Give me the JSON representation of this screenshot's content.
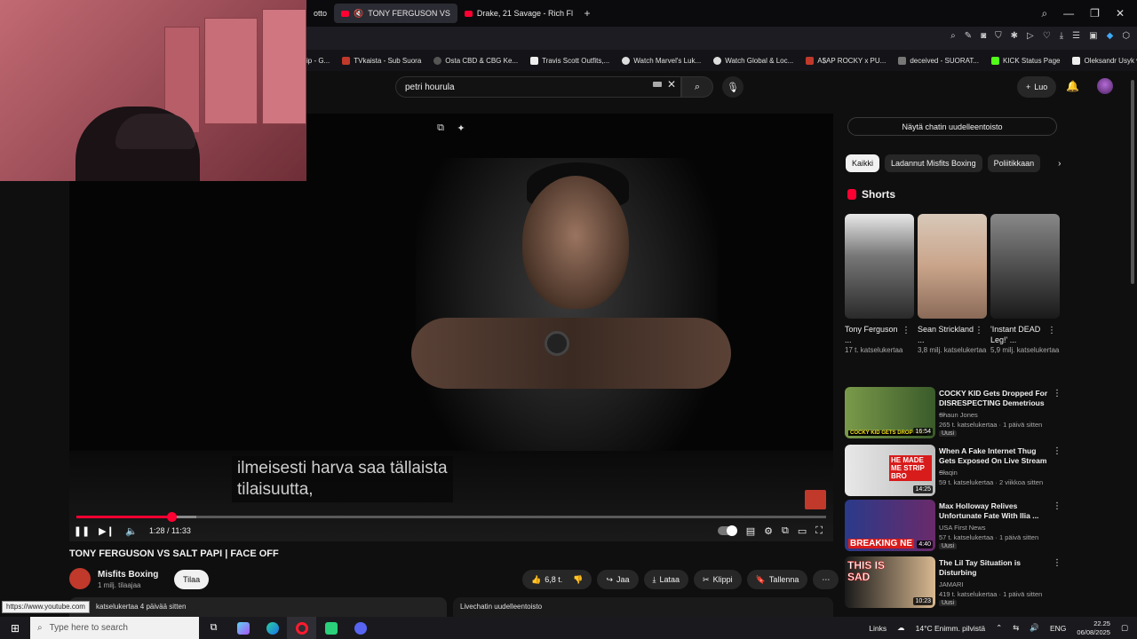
{
  "browser": {
    "tabs": [
      {
        "label": "otto"
      },
      {
        "label": "TONY FERGUSON VS",
        "active": true
      },
      {
        "label": "Drake, 21 Savage - Rich Fl"
      }
    ],
    "add_tab": "+",
    "bookmarks": [
      "ip - G...",
      "TVkaista - Sub Suora",
      "Osta CBD & CBG Ke...",
      "Travis Scott Outfits,...",
      "Watch Marvel's Luk...",
      "Watch Global & Loc...",
      "A$AP ROCKY x PU...",
      "deceived - SUORAT...",
      "KICK Status Page",
      "Oleksandr Usyk vs D..."
    ]
  },
  "youtube": {
    "search_value": "petri hourula",
    "create_label": "Luo"
  },
  "player": {
    "subtitle_line1": "ilmeisesti harva saa tällaista",
    "subtitle_line2": "tilaisuutta,",
    "time": "1:28 / 11:33",
    "progress": 0.127,
    "buffered": 0.16
  },
  "video": {
    "title": "TONY FERGUSON VS SALT PAPI | FACE OFF",
    "channel": "Misfits Boxing",
    "subscribers": "1 milj. tilaajaa",
    "subscribe_label": "Tilaa",
    "likes": "6,8 t.",
    "share": "Jaa",
    "download": "Lataa",
    "clip": "Klippi",
    "save": "Tallenna",
    "desc_text": "katselukertaa  4 päivää sitten",
    "status_url": "https://www.youtube.com",
    "live_chat_replay": "Livechatin uudelleentoisto"
  },
  "sidebar": {
    "show_chat": "Näytä chatin uudelleentoisto",
    "chips": [
      "Kaikki",
      "Ladannut Misfits Boxing",
      "Poliitikkaan"
    ],
    "shorts_title": "Shorts",
    "shorts": [
      {
        "title": "Tony Ferguson ...",
        "views": "17 t. katselukertaa"
      },
      {
        "title": "Sean Strickland ...",
        "views": "3,8 milj. katselukertaa"
      },
      {
        "title": "'Instant DEAD Leg!' ...",
        "views": "5,9 milj. katselukertaa"
      }
    ],
    "videos": [
      {
        "title": "COCKY KID Gets Dropped For DISRESPECTING Demetrious ...",
        "channel": "Shaun Jones",
        "meta": "265 t. katselukertaa · 1 päivä sitten",
        "badge": "Uusi",
        "duration": "16:54",
        "thumb_text": "COCKY KID GETS DROPPED!"
      },
      {
        "title": "When A Fake Internet Thug Gets Exposed On Live Stream ...",
        "channel": "Slaqin",
        "meta": "59 t. katselukertaa · 2 viikkoa sitten",
        "badge": "",
        "duration": "14:25",
        "thumb_text": "HE MADE ME STRIP BRO"
      },
      {
        "title": "Max Holloway Relives Unfortunate Fate With Ilia ...",
        "channel": "USA First News",
        "meta": "57 t. katselukertaa · 1 päivä sitten",
        "badge": "Uusi",
        "duration": "4:40",
        "thumb_text": "BREAKING NE"
      },
      {
        "title": "The Lil Tay Situation is Disturbing",
        "channel": "JAMARI",
        "meta": "419 t. katselukertaa · 1 päivä sitten",
        "badge": "Uusi",
        "duration": "10:23",
        "thumb_text": "THIS IS SAD"
      }
    ]
  },
  "taskbar": {
    "search_placeholder": "Type here to search",
    "links": "Links",
    "weather": "14°C  Enimm. pilvistä",
    "lang": "ENG",
    "time": "22.25",
    "date": "06/08/2025"
  }
}
